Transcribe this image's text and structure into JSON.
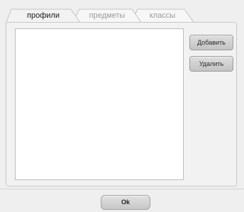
{
  "tabs": [
    {
      "label": "профили",
      "active": true
    },
    {
      "label": "предметы",
      "active": false
    },
    {
      "label": "классы",
      "active": false
    }
  ],
  "actions": {
    "add_label": "Добавить",
    "delete_label": "Удалить"
  },
  "list": {
    "items": []
  },
  "footer": {
    "ok_label": "Ok"
  },
  "colors": {
    "window_bg": "#efefef",
    "panel_bg": "#f2f2f2",
    "list_bg": "#ffffff",
    "button_gradient_top": "#dedede",
    "button_gradient_bottom": "#c3c3c3"
  }
}
